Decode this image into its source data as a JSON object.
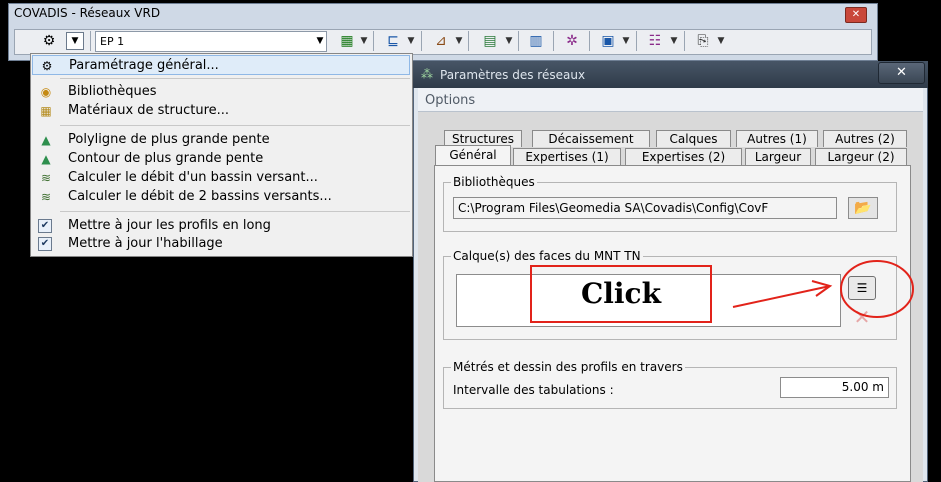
{
  "toolbar_window": {
    "title": "COVADIS - Réseaux VRD",
    "close_symbol": "✕",
    "layer_value": "EP 1"
  },
  "menu": {
    "items": [
      {
        "label": "Paramétrage général...",
        "icon": "settings-icon",
        "selected": true
      },
      {
        "label": "Bibliothèques",
        "icon": "library-icon"
      },
      {
        "label": "Matériaux de structure...",
        "icon": "materials-icon"
      },
      {
        "label": "Polyligne de plus grande pente",
        "icon": "terrain-icon"
      },
      {
        "label": "Contour de plus grande pente",
        "icon": "terrain-icon"
      },
      {
        "label": "Calculer le débit d'un bassin versant...",
        "icon": "watershed-icon"
      },
      {
        "label": "Calculer le débit de 2 bassins versants...",
        "icon": "watershed-icon"
      },
      {
        "label": "Mettre à jour les profils en long",
        "icon": "check-icon",
        "checked": true
      },
      {
        "label": "Mettre à jour l'habillage",
        "icon": "check-icon",
        "checked": true
      }
    ]
  },
  "dialog": {
    "title": "Paramètres des réseaux",
    "close_symbol": "✕",
    "options_label": "Options",
    "tabs_back": [
      "Structures",
      "Décaissement",
      "Calques",
      "Autres (1)",
      "Autres (2)"
    ],
    "tabs_front": [
      "Général",
      "Expertises (1)",
      "Expertises (2)",
      "Largeur",
      "Largeur (2)"
    ],
    "active_tab": "Général",
    "bibliotheques_label": "Bibliothèques",
    "bibliotheques_path": "C:\\Program Files\\Geomedia SA\\Covadis\\Config\\CovF",
    "calques_label": "Calque(s) des faces du MNT TN",
    "metres_label": "Métrés et dessin des profils en travers",
    "intervalle_label": "Intervalle des tabulations :",
    "intervalle_value": "5.00 m"
  },
  "annotation": {
    "click_text": "Click",
    "color": "#e2231a"
  }
}
